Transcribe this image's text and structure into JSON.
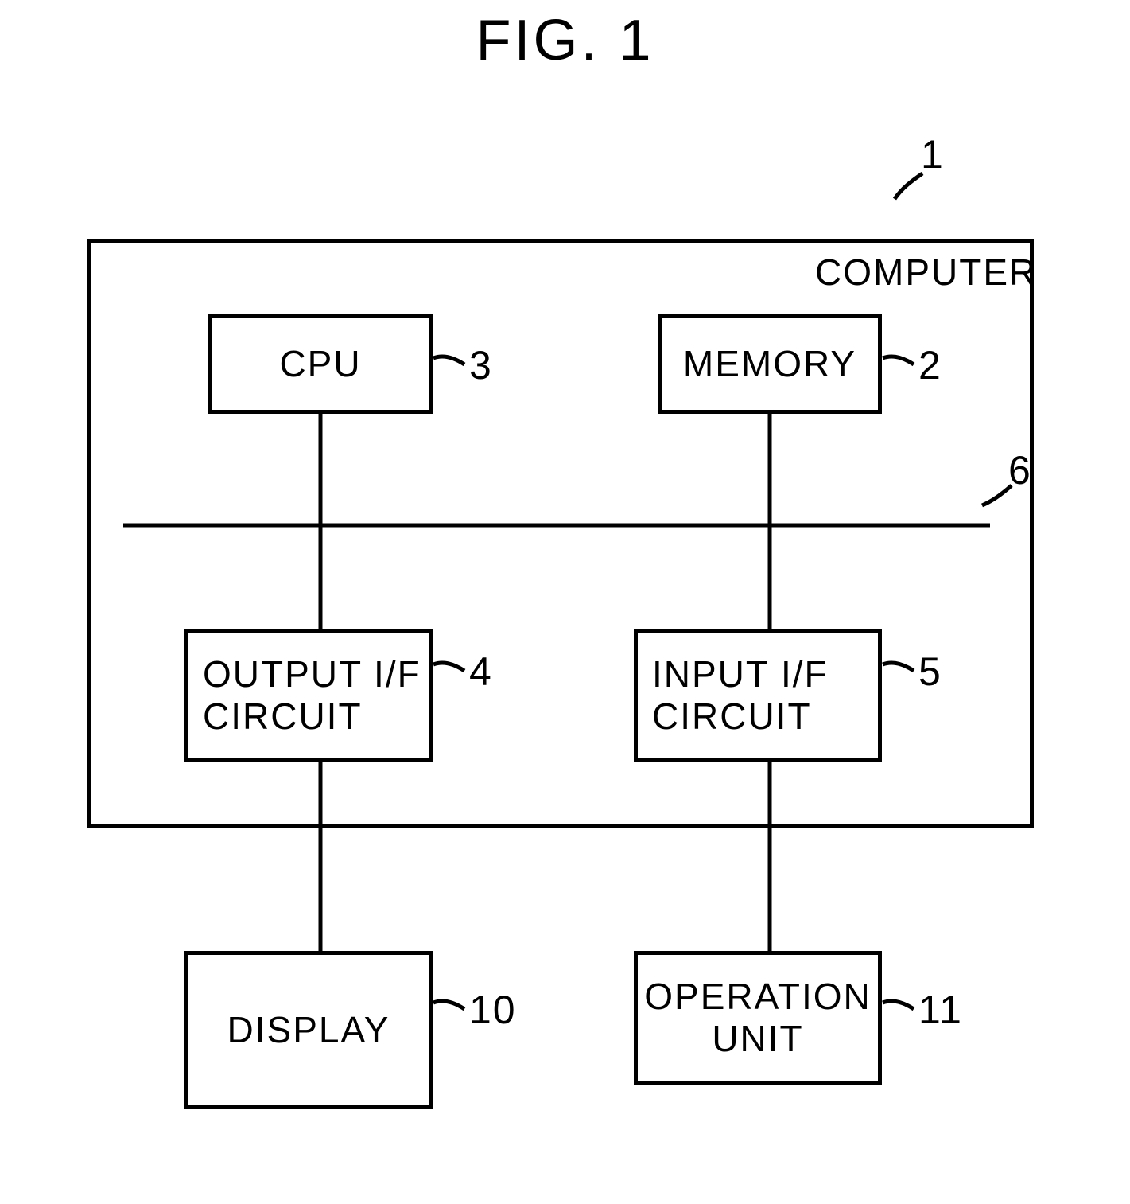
{
  "title": "FIG. 1",
  "labels": {
    "computer": "COMPUTER",
    "cpu": "CPU",
    "memory": "MEMORY",
    "output_if": "OUTPUT I/F\nCIRCUIT",
    "input_if": "INPUT I/F\nCIRCUIT",
    "display": "DISPLAY",
    "operation_unit": "OPERATION\nUNIT"
  },
  "refs": {
    "computer": "1",
    "memory": "2",
    "cpu": "3",
    "output_if": "4",
    "input_if": "5",
    "bus": "6",
    "display": "10",
    "operation_unit": "11"
  }
}
